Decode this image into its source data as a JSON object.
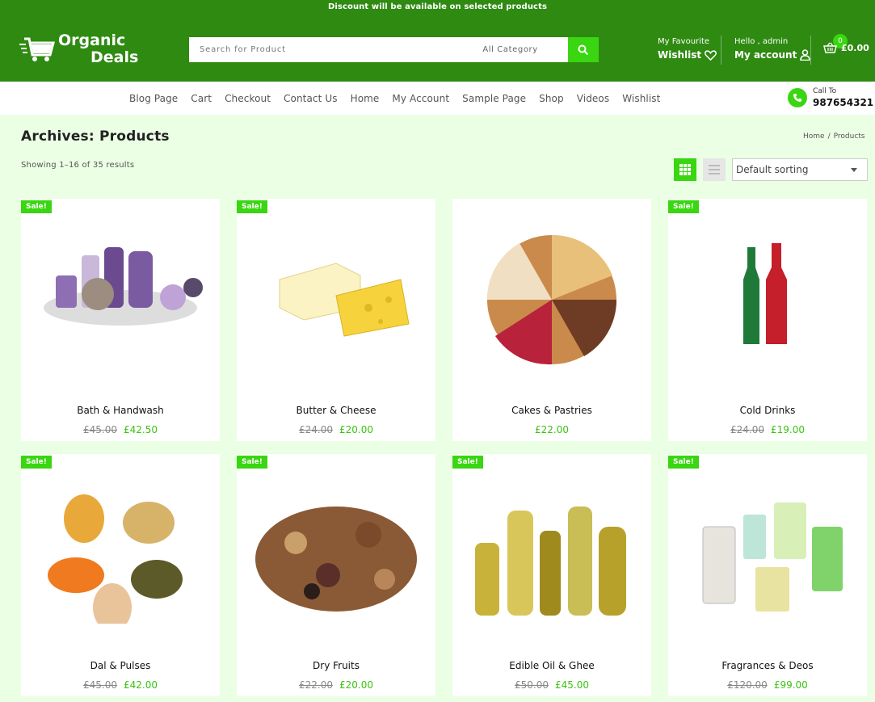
{
  "announcement": "Discount will be available on selected products",
  "brand": {
    "line1": "Organic",
    "line2": "Deals"
  },
  "search": {
    "placeholder": "Search for Product",
    "category": "All Category"
  },
  "favourite": {
    "caption": "My Favourite",
    "label": "Wishlist"
  },
  "account": {
    "greeting": "Hello , admin",
    "label": "My account"
  },
  "cart": {
    "count": "0",
    "total": "£0.00"
  },
  "nav": [
    "Blog Page",
    "Cart",
    "Checkout",
    "Contact Us",
    "Home",
    "My Account",
    "Sample Page",
    "Shop",
    "Videos",
    "Wishlist"
  ],
  "contact": {
    "caption": "Call To",
    "number": "987654321"
  },
  "page": {
    "title": "Archives: Products",
    "result_count": "Showing 1–16 of 35 results"
  },
  "breadcrumb": {
    "home": "Home",
    "sep": "/",
    "current": "Products"
  },
  "sorting": {
    "selected": "Default sorting"
  },
  "sale_label": "Sale!",
  "products": [
    {
      "name": "Bath & Handwash",
      "old": "£45.00",
      "price": "£42.50",
      "sale": true,
      "icon": "bath-products-image"
    },
    {
      "name": "Butter & Cheese",
      "old": "£24.00",
      "price": "£20.00",
      "sale": true,
      "icon": "butter-cheese-image"
    },
    {
      "name": "Cakes & Pastries",
      "old": "",
      "price": "£22.00",
      "sale": false,
      "icon": "cakes-image"
    },
    {
      "name": "Cold Drinks",
      "old": "£24.00",
      "price": "£19.00",
      "sale": true,
      "icon": "cold-drinks-image"
    },
    {
      "name": "Dal & Pulses",
      "old": "£45.00",
      "price": "£42.00",
      "sale": true,
      "icon": "pulses-image"
    },
    {
      "name": "Dry Fruits",
      "old": "£22.00",
      "price": "£20.00",
      "sale": true,
      "icon": "dry-fruits-image"
    },
    {
      "name": "Edible Oil & Ghee",
      "old": "£50.00",
      "price": "£45.00",
      "sale": true,
      "icon": "oil-bottles-image"
    },
    {
      "name": "Fragrances & Deos",
      "old": "£120.00",
      "price": "£99.00",
      "sale": true,
      "icon": "perfumes-image"
    }
  ],
  "colors": {
    "header_green": "#2f8a12",
    "accent_green": "#39d611",
    "page_bg": "#eaffe3"
  }
}
